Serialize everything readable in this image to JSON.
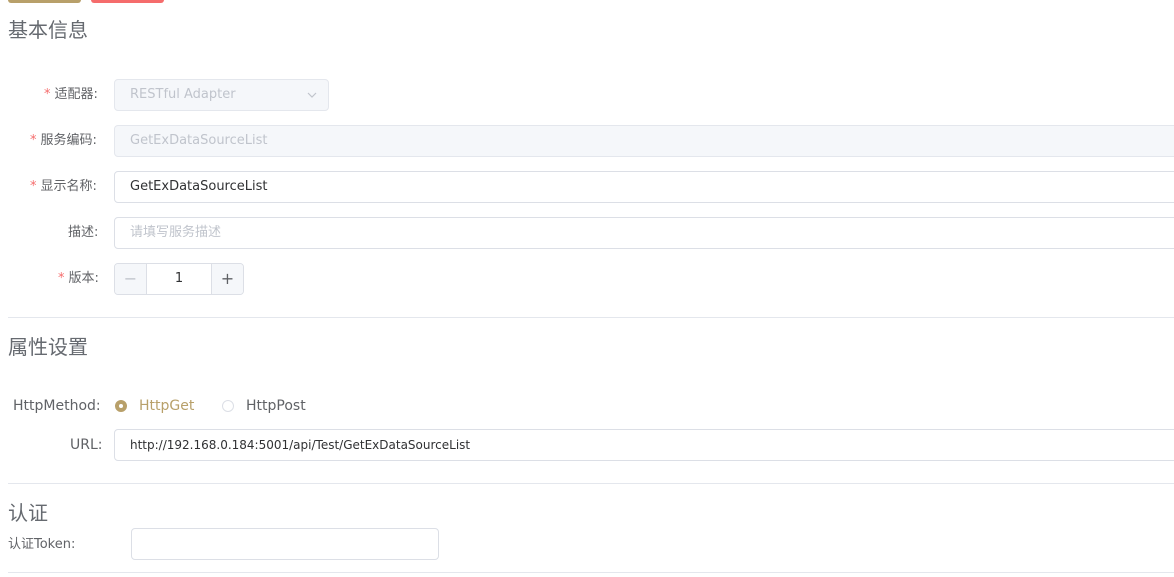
{
  "sections": {
    "basic": "基本信息",
    "properties": "属性设置",
    "auth": "认证"
  },
  "colors": {
    "accent": "#b8a06a",
    "danger": "#f56c6c",
    "required": "#f56c6c"
  },
  "form": {
    "adapter": {
      "label": "适配器:",
      "required": "*",
      "value": "RESTful Adapter",
      "icon": "chevron-down-icon"
    },
    "service_code": {
      "label": "服务编码:",
      "required": "*",
      "value": "GetExDataSourceList"
    },
    "display_name": {
      "label": "显示名称:",
      "required": "*",
      "value": "GetExDataSourceList"
    },
    "description": {
      "label": "描述:",
      "value": "",
      "placeholder": "请填写服务描述"
    },
    "version": {
      "label": "版本:",
      "required": "*",
      "value": "1",
      "minus": "−",
      "plus": "+"
    }
  },
  "properties": {
    "http_method": {
      "label": "HttpMethod:",
      "options": [
        "HttpGet",
        "HttpPost"
      ],
      "selected": "HttpGet"
    },
    "url": {
      "label": "URL:",
      "value": "http://192.168.0.184:5001/api/Test/GetExDataSourceList"
    }
  },
  "auth": {
    "token": {
      "label": "认证Token:",
      "value": ""
    }
  }
}
